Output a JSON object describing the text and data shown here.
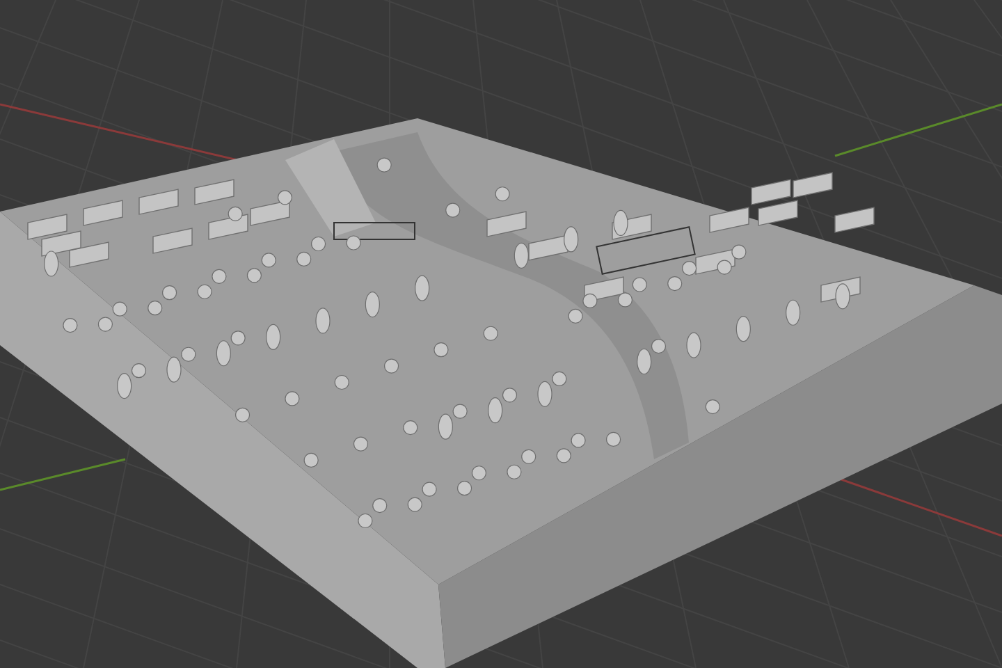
{
  "viewport": {
    "axes": [
      {
        "kind": "x",
        "color": "#8b3a3a"
      },
      {
        "kind": "y",
        "color": "#5a8a2a"
      }
    ]
  }
}
